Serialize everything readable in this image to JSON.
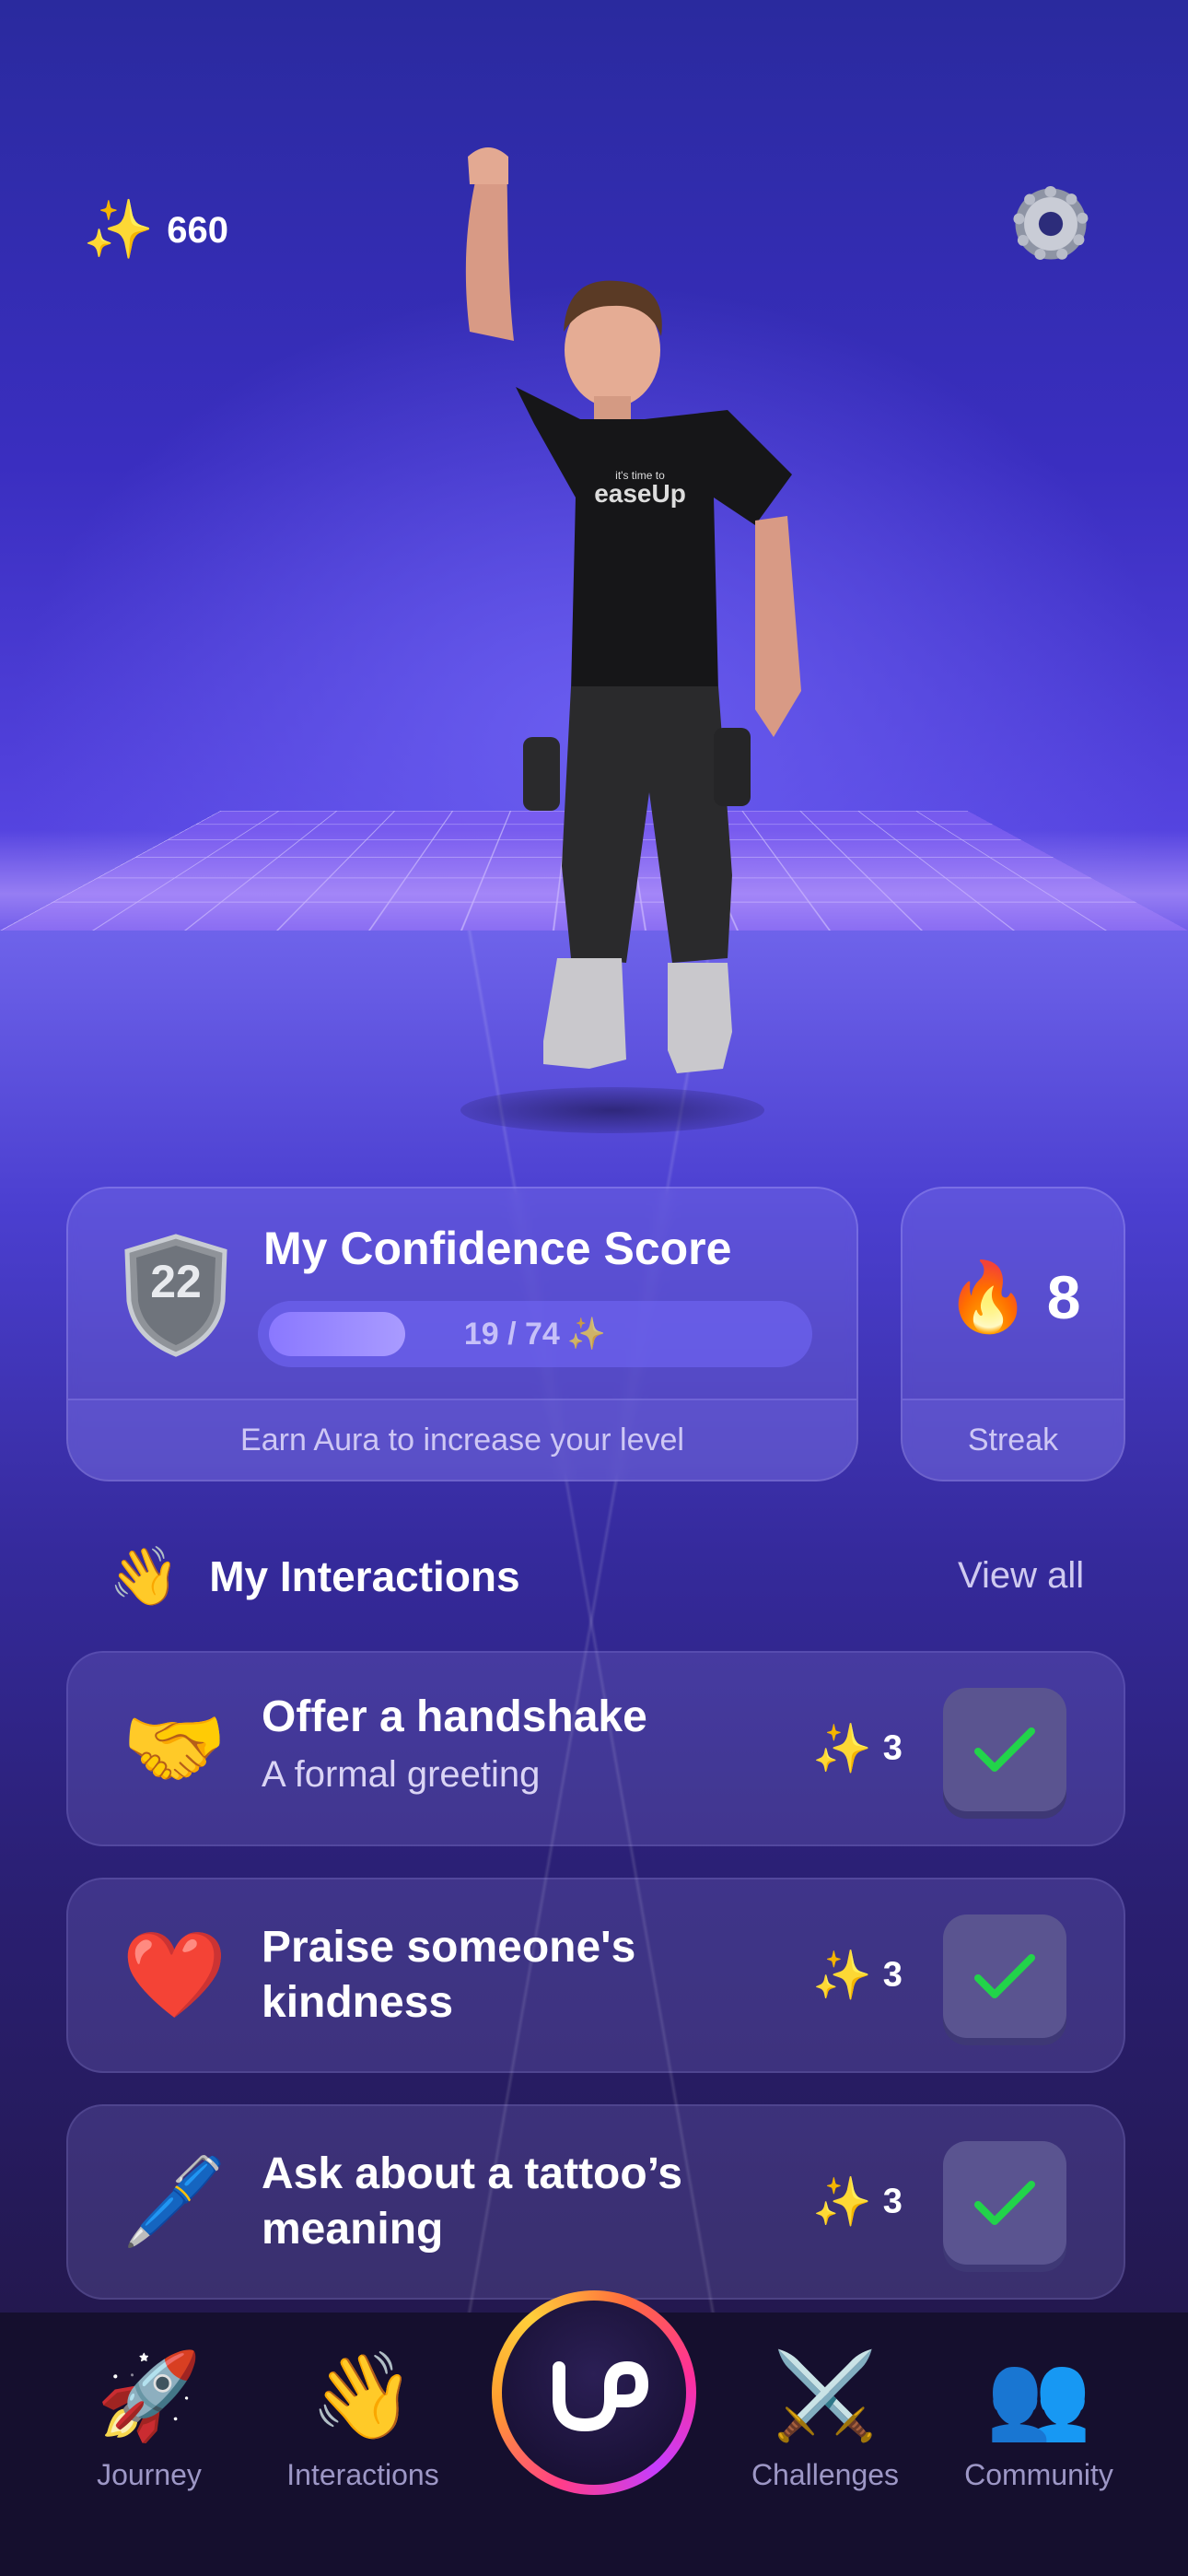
{
  "header": {
    "aura_count": "660",
    "sparkle_icon": "sparkles-icon",
    "settings_icon": "gear-icon"
  },
  "avatar": {
    "shirt_text_small": "it's time to",
    "shirt_text": "easeUp"
  },
  "confidence": {
    "level": "22",
    "title": "My Confidence Score",
    "progress_text": "19 / 74",
    "progress_current": 19,
    "progress_total": 74,
    "hint": "Earn Aura to increase your level"
  },
  "streak": {
    "value": "8",
    "label": "Streak",
    "icon": "fire-icon"
  },
  "interactions": {
    "title": "My Interactions",
    "view_all": "View all",
    "items": [
      {
        "title": "Offer a handshake",
        "subtitle": "A formal greeting",
        "points": "3",
        "icon": "handshake-icon",
        "emoji": "🤝"
      },
      {
        "title_line1": "Praise someone's",
        "title_line2": "kindness",
        "points": "3",
        "icon": "heart-icon",
        "emoji": "❤️"
      },
      {
        "title_line1": "Ask about a tattoo’s",
        "title_line2": "meaning",
        "points": "3",
        "icon": "pen-icon",
        "emoji": "🖊️"
      }
    ]
  },
  "nav": {
    "items": [
      {
        "label": "Journey",
        "icon": "rocket-icon",
        "emoji": "🚀"
      },
      {
        "label": "Interactions",
        "icon": "waving-hand-icon",
        "emoji": "👋"
      },
      {
        "label": "Challenges",
        "icon": "crossed-swords-icon",
        "emoji": "⚔️"
      },
      {
        "label": "Community",
        "icon": "people-icon",
        "emoji": "👥"
      }
    ],
    "center_icon": "easeup-logo-icon"
  },
  "colors": {
    "accent": "#6c5ce7",
    "check": "#22c55e",
    "fire": "#ff6a2a"
  }
}
